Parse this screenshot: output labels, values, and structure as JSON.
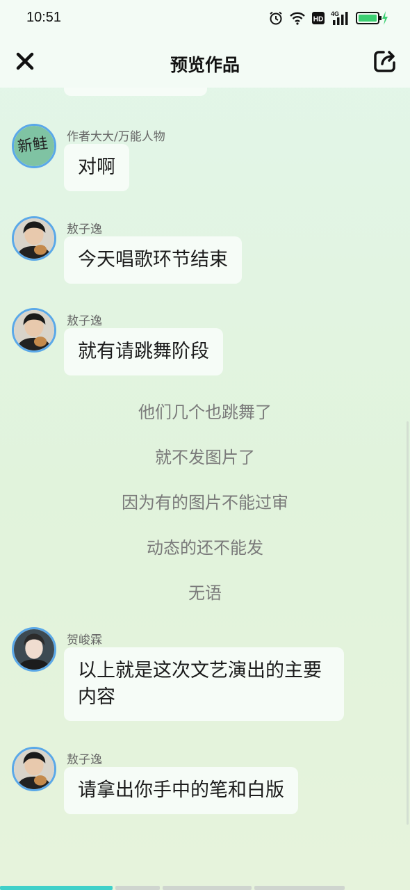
{
  "status_bar": {
    "time": "10:51",
    "icons": [
      "alarm-icon",
      "wifi-icon",
      "hd-icon",
      "signal-4g-icon",
      "battery-charging-icon"
    ],
    "hd_label": "HD",
    "network_label": "4G",
    "battery_color": "#3ccf72"
  },
  "header": {
    "title": "预览作品",
    "close_icon": "close-icon",
    "share_icon": "share-icon"
  },
  "messages": [
    {
      "name": "作者大大/万能人物",
      "text": "对啊",
      "avatar": "avatar-xinge"
    },
    {
      "name": "敖子逸",
      "text": "今天唱歌环节结束",
      "avatar": "avatar-aoziyi"
    },
    {
      "name": "敖子逸",
      "text": "就有请跳舞阶段",
      "avatar": "avatar-aoziyi"
    },
    {
      "name": "贺峻霖",
      "text": "以上就是这次文艺演出的主要内容",
      "avatar": "avatar-hejunlin"
    },
    {
      "name": "敖子逸",
      "text": "请拿出你手中的笔和白版",
      "avatar": "avatar-aoziyi"
    }
  ],
  "avatar_text": "新鲑",
  "narration": [
    "他们几个也跳舞了",
    "就不发图片了",
    "因为有的图片不能过审",
    "动态的还不能发",
    "无语"
  ],
  "colors": {
    "avatar_border": "#5aa8e8",
    "bubble_bg": "#f6fcf7",
    "progress_active": "#3fd0c9",
    "progress_inactive": "#cfd5cf"
  },
  "progress": {
    "segments": 4,
    "active_segment": 1
  }
}
